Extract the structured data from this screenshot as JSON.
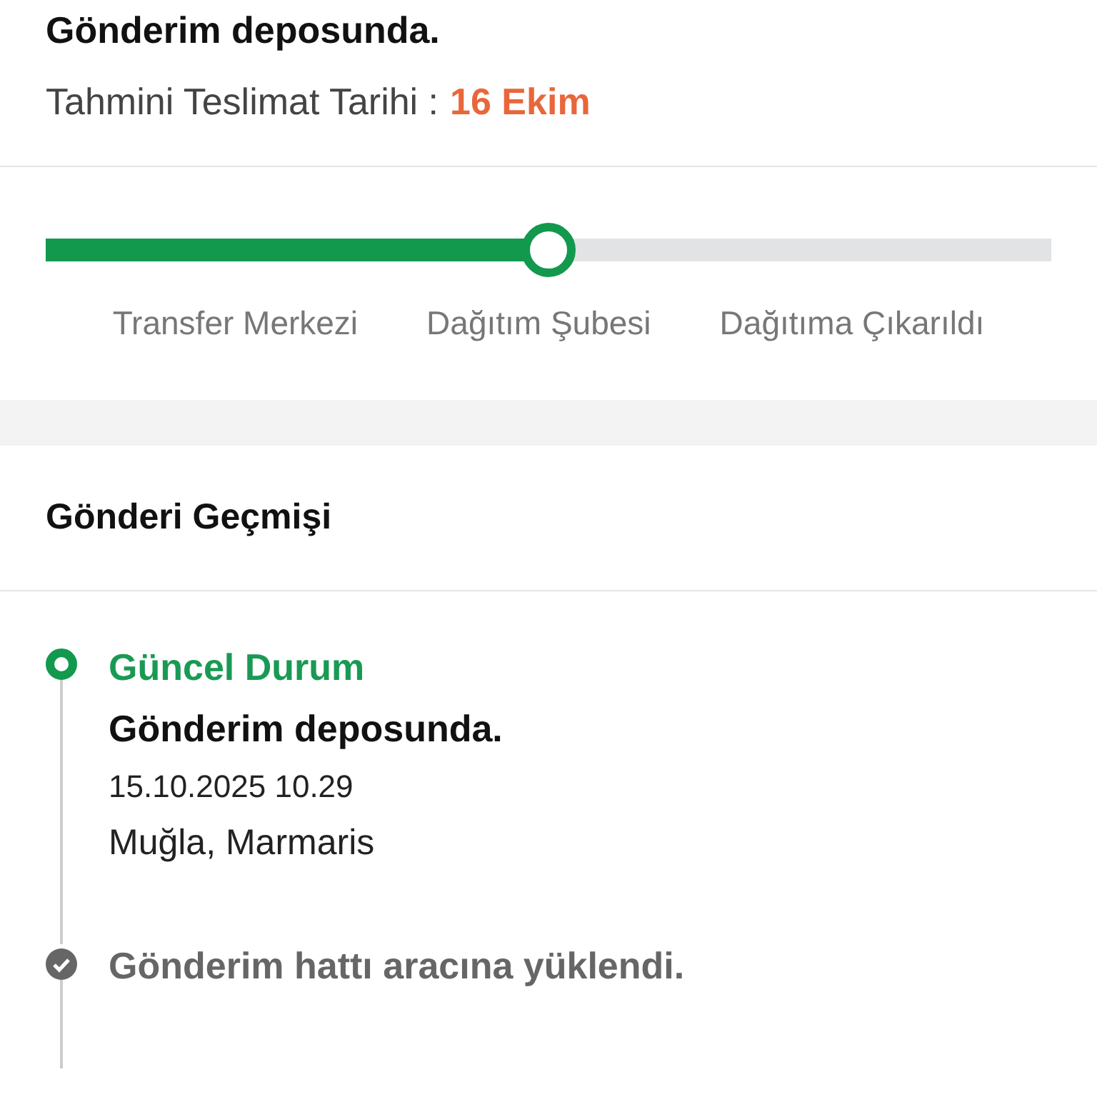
{
  "status": {
    "title": "Gönderim deposunda.",
    "estimate_label": "Tahmini Teslimat Tarihi :",
    "estimate_value": "16 Ekim"
  },
  "progress": {
    "level": 0.5,
    "steps": [
      "Transfer Merkezi",
      "Dağıtım Şubesi",
      "Dağıtıma Çıkarıldı"
    ]
  },
  "history": {
    "title": "Gönderi Geçmişi",
    "events": [
      {
        "kind": "current",
        "label": "Güncel Durum",
        "title": "Gönderim deposunda.",
        "date": "15.10.2025 10.29",
        "location": "Muğla, Marmaris"
      },
      {
        "kind": "past",
        "title": "Gönderim hattı aracına yüklendi."
      }
    ]
  }
}
